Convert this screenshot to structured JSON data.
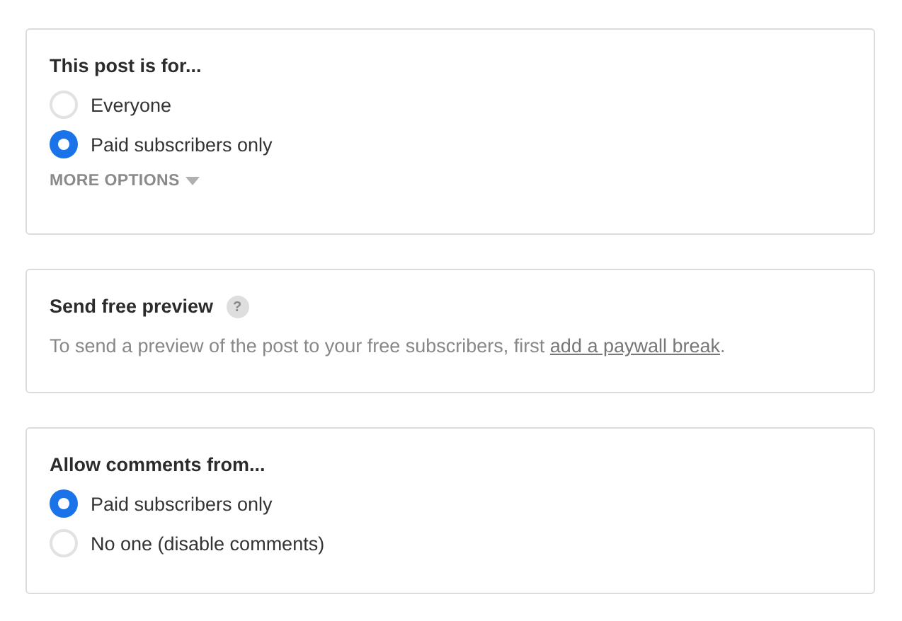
{
  "sections": [
    {
      "kind": "radio",
      "title": "This post is for...",
      "options": [
        {
          "label": "Everyone",
          "selected": false
        },
        {
          "label": "Paid subscribers only",
          "selected": true
        }
      ],
      "more_options": "MORE OPTIONS"
    },
    {
      "kind": "info",
      "title": "Send free preview",
      "help": "?",
      "text_before": "To send a preview of the post to your free subscribers, first ",
      "link": "add a paywall break",
      "text_after": "."
    },
    {
      "kind": "radio",
      "title": "Allow comments from...",
      "options": [
        {
          "label": "Paid subscribers only",
          "selected": true
        },
        {
          "label": "No one (disable comments)",
          "selected": false
        }
      ]
    }
  ]
}
